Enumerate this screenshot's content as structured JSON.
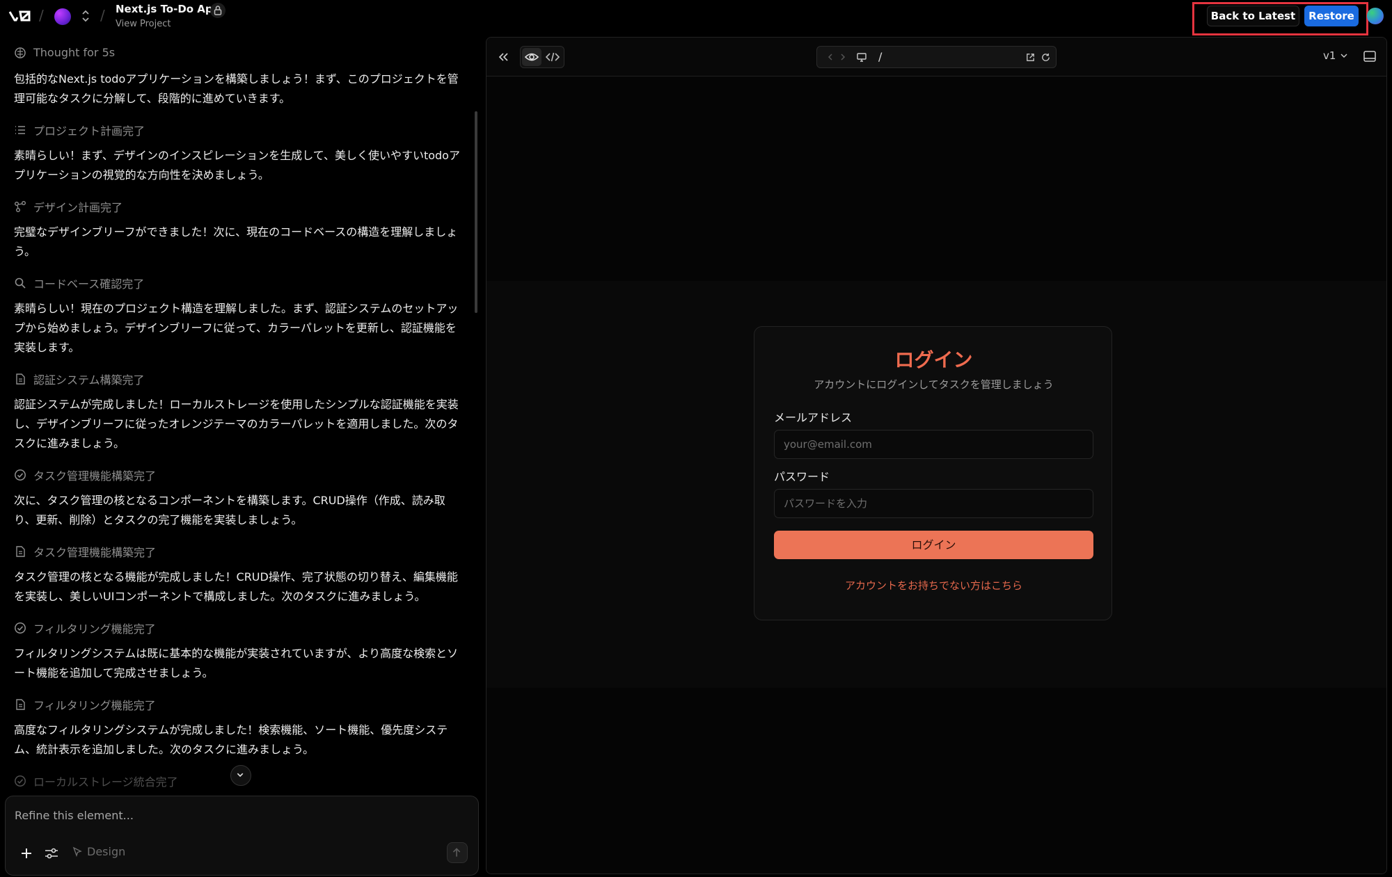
{
  "header": {
    "project_title": "Next.js To-Do App",
    "project_link": "View Project",
    "back_label": "Back to Latest",
    "restore_label": "Restore"
  },
  "chat": {
    "thought": "Thought for 5s",
    "items": [
      {
        "type": "text",
        "text": "包括的なNext.js todoアプリケーションを構築しましょう！まず、このプロジェクトを管理可能なタスクに分解して、段階的に進めていきます。"
      },
      {
        "type": "step",
        "icon": "list-icon",
        "text": "プロジェクト計画完了"
      },
      {
        "type": "text",
        "text": "素晴らしい！まず、デザインのインスピレーションを生成して、美しく使いやすいtodoアプリケーションの視覚的な方向性を決めましょう。"
      },
      {
        "type": "step",
        "icon": "design-nodes-icon",
        "text": "デザイン計画完了"
      },
      {
        "type": "text",
        "text": "完璧なデザインブリーフができました！次に、現在のコードベースの構造を理解しましょう。"
      },
      {
        "type": "step",
        "icon": "search-icon",
        "text": "コードベース確認完了"
      },
      {
        "type": "text",
        "text": "素晴らしい！現在のプロジェクト構造を理解しました。まず、認証システムのセットアップから始めましょう。デザインブリーフに従って、カラーパレットを更新し、認証機能を実装します。"
      },
      {
        "type": "step",
        "icon": "file-icon",
        "text": "認証システム構築完了"
      },
      {
        "type": "text",
        "text": "認証システムが完成しました！ローカルストレージを使用したシンプルな認証機能を実装し、デザインブリーフに従ったオレンジテーマのカラーパレットを適用しました。次のタスクに進みましょう。"
      },
      {
        "type": "step",
        "icon": "check-circle-icon",
        "text": "タスク管理機能構築完了"
      },
      {
        "type": "text",
        "text": "次に、タスク管理の核となるコンポーネントを構築します。CRUD操作（作成、読み取り、更新、削除）とタスクの完了機能を実装しましょう。"
      },
      {
        "type": "step",
        "icon": "file-icon",
        "text": "タスク管理機能構築完了"
      },
      {
        "type": "text",
        "text": "タスク管理の核となる機能が完成しました！CRUD操作、完了状態の切り替え、編集機能を実装し、美しいUIコンポーネントで構成しました。次のタスクに進みましょう。"
      },
      {
        "type": "step",
        "icon": "check-circle-icon",
        "text": "フィルタリング機能完了"
      },
      {
        "type": "text",
        "text": "フィルタリングシステムは既に基本的な機能が実装されていますが、より高度な検索とソート機能を追加して完成させましょう。"
      },
      {
        "type": "step",
        "icon": "file-icon",
        "text": "フィルタリング機能完了"
      },
      {
        "type": "text",
        "text": "高度なフィルタリングシステムが完成しました！検索機能、ソート機能、優先度システム、統計表示を追加しました。次のタスクに進みましょう。"
      },
      {
        "type": "step",
        "icon": "check-circle-icon",
        "text": "ローカルストレージ統合完了"
      }
    ]
  },
  "composer": {
    "placeholder": "Refine this element...",
    "design_label": "Design"
  },
  "preview": {
    "url_path": "/",
    "version": "v1"
  },
  "login": {
    "title": "ログイン",
    "subtitle": "アカウントにログインしてタスクを管理しましょう",
    "email_label": "メールアドレス",
    "email_placeholder": "your@email.com",
    "password_label": "パスワード",
    "password_placeholder": "パスワードを入力",
    "submit_label": "ログイン",
    "signup_link": "アカウントをお持ちでない方はこちら"
  },
  "colors": {
    "accent_orange": "#ec7456",
    "restore_blue": "#1a6be0",
    "highlight_red": "#e5343f"
  }
}
